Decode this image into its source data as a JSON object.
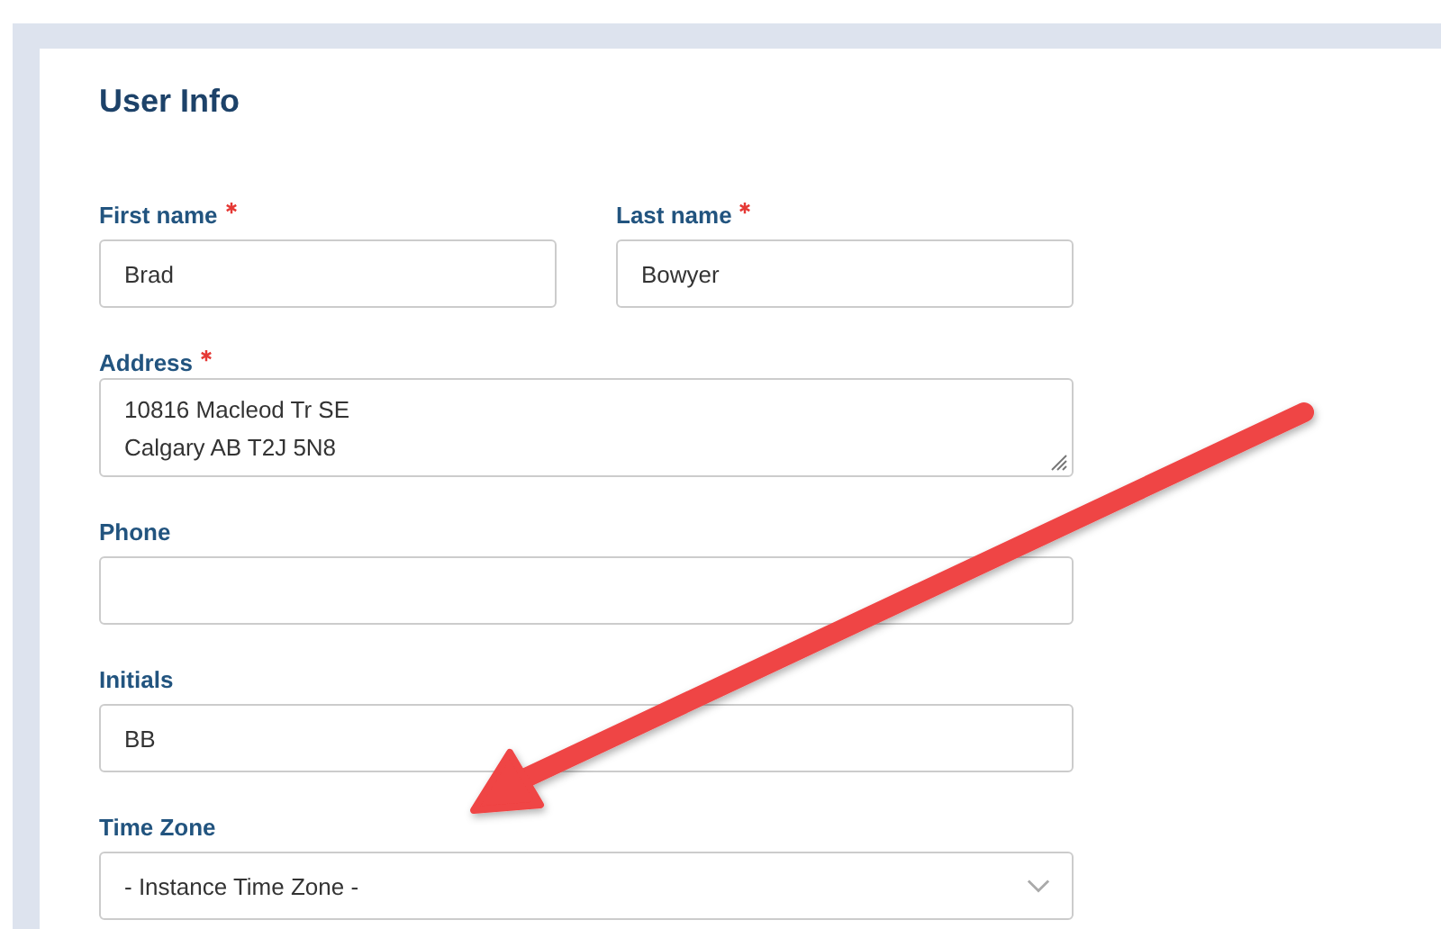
{
  "section": {
    "title": "User Info"
  },
  "rows": [
    {
      "fields": [
        {
          "kind": "text",
          "label": "First name",
          "required": true,
          "value": "Brad"
        },
        {
          "kind": "text",
          "label": "Last name",
          "required": true,
          "value": "Bowyer"
        }
      ]
    },
    {
      "fields": [
        {
          "kind": "textarea",
          "label": "Address",
          "required": true,
          "value": "10816 Macleod Tr SE\nCalgary AB T2J 5N8"
        }
      ]
    },
    {
      "fields": [
        {
          "kind": "text",
          "label": "Phone",
          "required": false
        }
      ]
    },
    {
      "fields": [
        {
          "kind": "text",
          "label": "Initials",
          "required": false,
          "value": "BB"
        }
      ]
    },
    {
      "fields": [
        {
          "kind": "select",
          "label": "Time Zone",
          "required": false,
          "value": "- Instance Time Zone -"
        }
      ]
    }
  ]
}
